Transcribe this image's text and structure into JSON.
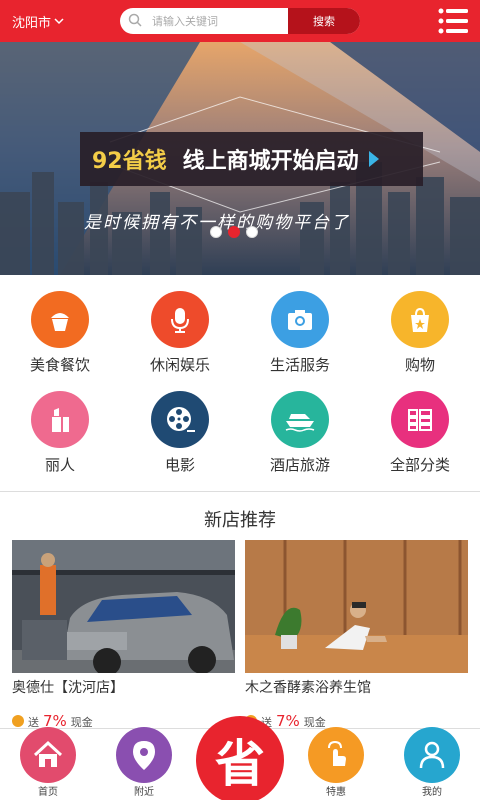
{
  "header": {
    "city": "沈阳市",
    "search_placeholder": "请输入关键词",
    "search_button": "搜索"
  },
  "banner": {
    "headline_highlight": "92省钱",
    "headline_main": "线上商城开始启动",
    "subline": "是时候拥有不一样的购物平台了",
    "active_slide": 2,
    "total_slides": 3
  },
  "categories": [
    {
      "label": "美食餐饮",
      "color": "#f26b21",
      "icon": "cupcake-icon"
    },
    {
      "label": "休闲娱乐",
      "color": "#ee4b2b",
      "icon": "microphone-icon"
    },
    {
      "label": "生活服务",
      "color": "#3c9fe3",
      "icon": "camera-icon"
    },
    {
      "label": "购物",
      "color": "#f7b52b",
      "icon": "shopping-bag-icon"
    },
    {
      "label": "丽人",
      "color": "#ef6a8f",
      "icon": "lipstick-icon"
    },
    {
      "label": "电影",
      "color": "#1f4a73",
      "icon": "film-reel-icon"
    },
    {
      "label": "酒店旅游",
      "color": "#27b59c",
      "icon": "boat-icon"
    },
    {
      "label": "全部分类",
      "color": "#e8307e",
      "icon": "grid-list-icon"
    }
  ],
  "new_stores": {
    "title": "新店推荐",
    "items": [
      {
        "name": "奥德仕【沈河店】",
        "promo_prefix": "送",
        "promo_value": "7%",
        "promo_suffix": "现金"
      },
      {
        "name": "木之香酵素浴养生馆",
        "promo_prefix": "送",
        "promo_value": "7%",
        "promo_suffix": "现金"
      }
    ]
  },
  "bottom_nav": {
    "items": [
      {
        "label": "首页",
        "color": "#e24b6d",
        "icon": "home-icon"
      },
      {
        "label": "附近",
        "color": "#8a4fb0",
        "icon": "location-pin-icon"
      },
      {
        "label": "特惠",
        "color": "#f59a24",
        "icon": "hand-tap-icon"
      },
      {
        "label": "我的",
        "color": "#26a6cf",
        "icon": "user-icon"
      }
    ],
    "center_label": "省",
    "center_color": "#e8242e"
  }
}
